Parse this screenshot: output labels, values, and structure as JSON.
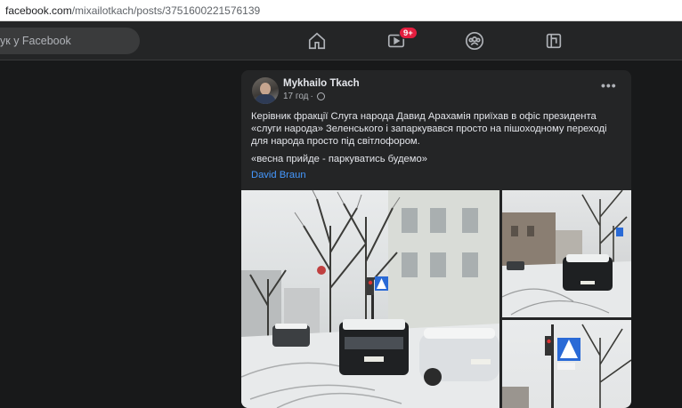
{
  "browser": {
    "url_host": "facebook.com",
    "url_path": "/mixailotkach/posts/3751600221576139"
  },
  "topbar": {
    "search_text": "ук у Facebook",
    "nav": [
      {
        "icon": "home-icon"
      },
      {
        "icon": "watch-icon",
        "badge": "9+"
      },
      {
        "icon": "groups-icon"
      },
      {
        "icon": "gaming-icon"
      }
    ]
  },
  "post": {
    "author": "Mykhailo Tkach",
    "time": "17 год",
    "separator": "·",
    "text_lines": [
      "Керівник фракції Слуга народа Давид Арахамія приїхав в офіс президента «слуги народа» Зеленського і запаркувався просто на пішоходному переході для народа просто під світлофором.",
      "«весна прийде - паркуватись будемо»"
    ],
    "tag": "David Braun",
    "more_label": "•••"
  },
  "colors": {
    "background": "#18191a",
    "card": "#242526",
    "text": "#e4e6eb",
    "secondary_text": "#b0b3b8",
    "link": "#4599ff",
    "badge": "#e41e3f"
  }
}
